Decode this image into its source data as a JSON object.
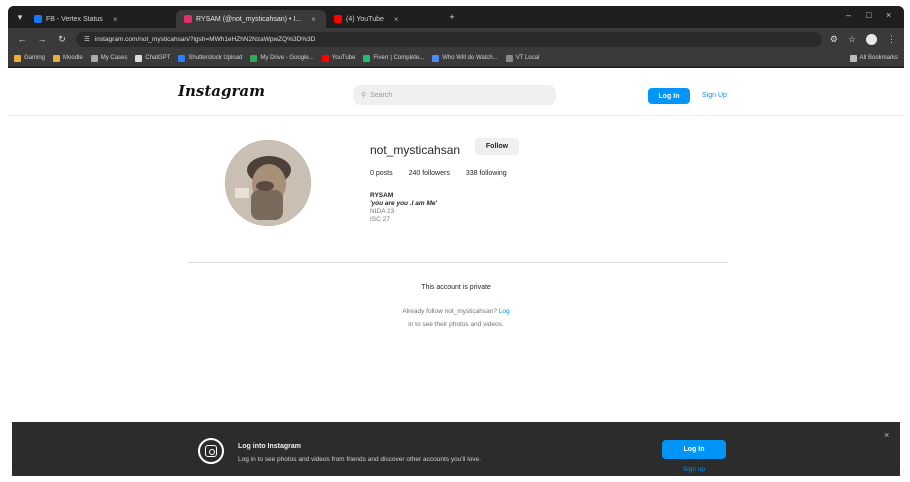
{
  "browser": {
    "tabs": [
      {
        "label": "FB - Vertex Status",
        "favicon": "fb-icon",
        "color": "#1877f2",
        "active": false
      },
      {
        "label": "RYSAM (@not_mysticahsan) • I...",
        "favicon": "instagram-icon",
        "color": "#e1306c",
        "active": true
      },
      {
        "label": "(4) YouTube",
        "favicon": "youtube-icon",
        "color": "#ff0000",
        "active": false
      }
    ],
    "new_tab": "+",
    "url": "instagram.com/not_mysticahsan/?igsh=MWh1eHZhN2NzaWpwZQ%3D%3D",
    "bookmarks": [
      {
        "label": "Gaming",
        "color": "#f2a93b"
      },
      {
        "label": "Moodle",
        "color": "#f2a93b"
      },
      {
        "label": "My Cases",
        "color": "#aaaaaa"
      },
      {
        "label": "ChatGPT",
        "color": "#dddddd"
      },
      {
        "label": "Shutterstock Upload",
        "color": "#2d7ff9"
      },
      {
        "label": "My Drive - Google...",
        "color": "#34a853"
      },
      {
        "label": "YouTube",
        "color": "#ff0000"
      },
      {
        "label": "Fiverr | Complete...",
        "color": "#1dbf73"
      },
      {
        "label": "Who Will do Watch...",
        "color": "#4c8bf5"
      },
      {
        "label": "VT Local",
        "color": "#888888"
      }
    ],
    "all_bookmarks": "All Bookmarks"
  },
  "header": {
    "logo": "Instagram",
    "search_placeholder": "Search",
    "login_label": "Log In",
    "signup_label": "Sign Up"
  },
  "profile": {
    "username": "not_mysticahsan",
    "follow_label": "Follow",
    "posts": "0 posts",
    "followers": "240 followers",
    "following": "338 following",
    "bio_name": "RYSAM",
    "bio_quote": "'you are you .I am Me'",
    "bio_line3": "NIDA 23",
    "bio_line4": "ISC 27"
  },
  "private": {
    "title": "This account is private",
    "line1_prefix": "Already follow not_mysticahsan? ",
    "line1_link": "Log",
    "line2": "in to see their photos and videos."
  },
  "banner": {
    "title": "Log into Instagram",
    "subtitle": "Log in to see photos and videos from friends and discover other accounts you'll love.",
    "login_label": "Log In",
    "signup_label": "Sign up"
  },
  "colors": {
    "accent": "#0095f6",
    "browser_bg": "#1f1f1f",
    "banner_bg": "#2c2c2c"
  }
}
